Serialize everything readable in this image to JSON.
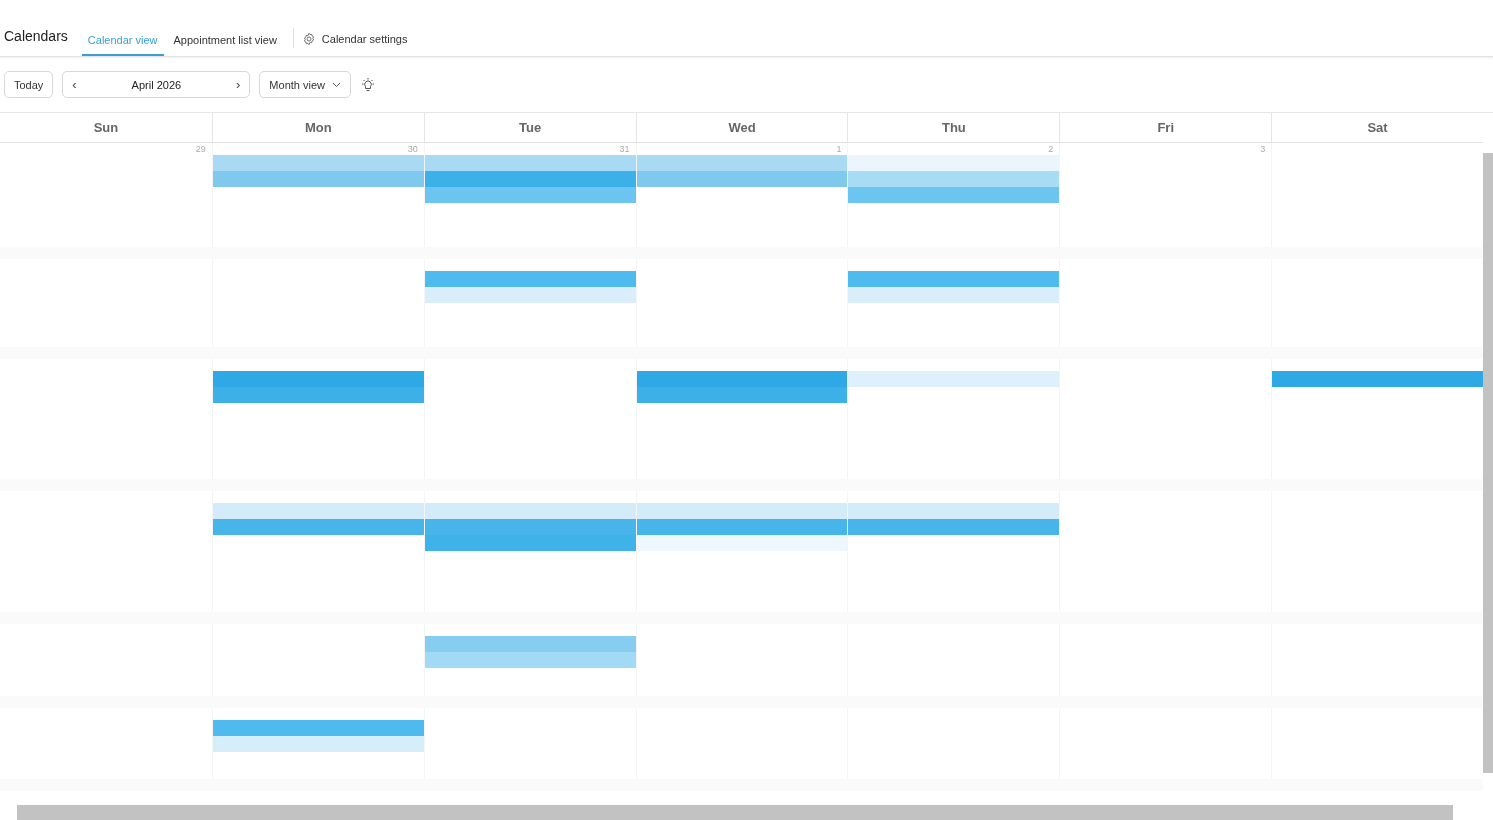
{
  "header": {
    "title": "Calendars",
    "tabs": [
      {
        "label": "Calendar view",
        "selected": true
      },
      {
        "label": "Appointment list view",
        "selected": false
      }
    ],
    "settings": "Calendar settings"
  },
  "toolbar": {
    "today": "Today",
    "prev": "‹",
    "period": "April 2026",
    "next": "›",
    "view": "Month view"
  },
  "weekdays": [
    "Sun",
    "Mon",
    "Tue",
    "Wed",
    "Thu",
    "Fri",
    "Sat"
  ],
  "weeks": [
    {
      "days": [
        {
          "kind": "day",
          "date": "29"
        },
        {
          "kind": "day",
          "date": "30",
          "events": [
            {
              "color": "#a9daf3"
            },
            {
              "color": "#7fc9ee"
            }
          ]
        },
        {
          "kind": "day",
          "date": "31",
          "events": [
            {
              "color": "#a9daf3"
            },
            {
              "color": "#3cb0e8"
            },
            {
              "color": "#6cc5f0"
            }
          ]
        },
        {
          "kind": "day",
          "date": "1",
          "events": [
            {
              "color": "#a9daf3"
            },
            {
              "color": "#7fc9ee"
            }
          ]
        },
        {
          "kind": "day",
          "date": "2",
          "events": [
            {
              "color": "#eaf5fd"
            },
            {
              "color": "#a8dcf5"
            },
            {
              "color": "#6cc5f0"
            }
          ]
        },
        {
          "kind": "day",
          "date": "3"
        },
        {
          "kind": "blank"
        }
      ]
    },
    {
      "days": [
        {
          "kind": "blank"
        },
        {
          "kind": "blank"
        },
        {
          "kind": "day",
          "events": [
            {
              "color": "#4fbaee"
            },
            {
              "color": "#d9eefa"
            }
          ]
        },
        {
          "kind": "blank"
        },
        {
          "kind": "day",
          "events": [
            {
              "color": "#4fbaee"
            },
            {
              "color": "#d9eefa"
            }
          ]
        },
        {
          "kind": "blank"
        },
        {
          "kind": "blank"
        }
      ]
    },
    {
      "days": [
        {
          "kind": "blank"
        },
        {
          "kind": "day",
          "events": [
            {
              "color": "#2fa8e6"
            },
            {
              "color": "#3eb0e8"
            }
          ]
        },
        {
          "kind": "blank"
        },
        {
          "kind": "day",
          "events": [
            {
              "color": "#2fa8e6"
            },
            {
              "color": "#3eb0e8"
            }
          ]
        },
        {
          "kind": "day",
          "events": [
            {
              "color": "#def0fb"
            }
          ]
        },
        {
          "kind": "blank"
        },
        {
          "kind": "day",
          "events": [
            {
              "color": "#2fa8e6"
            }
          ]
        }
      ]
    },
    {
      "days": [
        {
          "kind": "blank"
        },
        {
          "kind": "day",
          "events": [
            {
              "color": "#d4ecf9"
            },
            {
              "color": "#48b5ea"
            }
          ]
        },
        {
          "kind": "day",
          "events": [
            {
              "color": "#d4ecf9"
            },
            {
              "color": "#48b5ea"
            },
            {
              "color": "#40b2ea"
            }
          ]
        },
        {
          "kind": "day",
          "events": [
            {
              "color": "#d4ecf9"
            },
            {
              "color": "#48b5ea"
            },
            {
              "color": "#eef7fd"
            }
          ]
        },
        {
          "kind": "day",
          "events": [
            {
              "color": "#d4ecf9"
            },
            {
              "color": "#48b5ea"
            }
          ]
        },
        {
          "kind": "blank"
        },
        {
          "kind": "blank"
        }
      ]
    },
    {
      "days": [
        {
          "kind": "blank"
        },
        {
          "kind": "blank"
        },
        {
          "kind": "day",
          "events": [
            {
              "color": "#86cdf0"
            },
            {
              "color": "#a2d9f4"
            }
          ]
        },
        {
          "kind": "blank"
        },
        {
          "kind": "blank"
        },
        {
          "kind": "blank"
        },
        {
          "kind": "blank"
        }
      ]
    },
    {
      "days": [
        {
          "kind": "blank"
        },
        {
          "kind": "day",
          "events": [
            {
              "color": "#4fbaee"
            },
            {
              "color": "#d6edfa"
            }
          ]
        },
        {
          "kind": "blank"
        },
        {
          "kind": "blank"
        },
        {
          "kind": "blank"
        },
        {
          "kind": "blank"
        },
        {
          "kind": "blank"
        }
      ]
    }
  ]
}
